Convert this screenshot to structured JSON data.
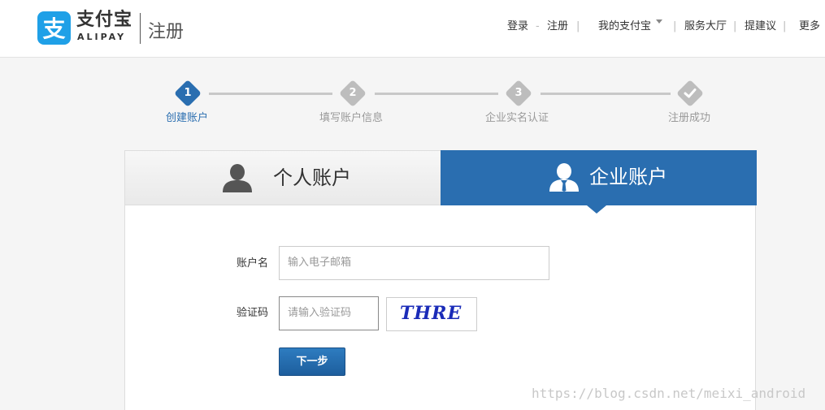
{
  "header": {
    "logo_cn": "支付宝",
    "logo_en": "ALIPAY",
    "subtitle": "注册",
    "nav": {
      "login": "登录",
      "dot": "-",
      "register": "注册",
      "my_alipay": "我的支付宝",
      "service_hall": "服务大厅",
      "suggest": "提建议",
      "more": "更多"
    }
  },
  "steps": [
    {
      "num": "1",
      "label": "创建账户",
      "state": "active"
    },
    {
      "num": "2",
      "label": "填写账户信息",
      "state": "pending"
    },
    {
      "num": "3",
      "label": "企业实名认证",
      "state": "pending"
    },
    {
      "num": "",
      "label": "注册成功",
      "state": "pending",
      "icon": "check-icon"
    }
  ],
  "tabs": {
    "personal": {
      "label": "个人账户",
      "icon": "user-icon",
      "selected": false
    },
    "company": {
      "label": "企业账户",
      "icon": "business-user-icon",
      "selected": true
    }
  },
  "form": {
    "account_label": "账户名",
    "account_placeholder": "输入电子邮箱",
    "captcha_label": "验证码",
    "captcha_placeholder": "请输入验证码",
    "captcha_image_text": "THRE",
    "next_button": "下一步"
  },
  "colors": {
    "brand_blue": "#1fa0e7",
    "accent": "#2a6eb0"
  },
  "watermark": "https://blog.csdn.net/meixi_android"
}
